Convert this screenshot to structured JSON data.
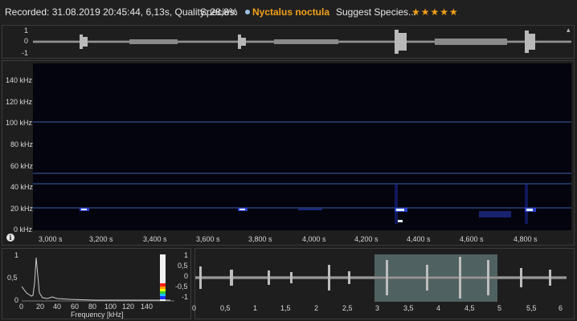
{
  "header": {
    "recorded": "Recorded: 31.08.2019 20:45:44, 6,13s, Quality: 28,8%",
    "species_label": "Species:",
    "species_name": "Nyctalus noctula",
    "suggest_label": "Suggest Species...",
    "stars": "★★★★★",
    "accent_color": "#f2a019"
  },
  "waveform_top": {
    "y_ticks": [
      "1",
      "0",
      "-1"
    ]
  },
  "spectrogram": {
    "y_ticks": [
      "140 kHz",
      "120 kHz",
      "100 kHz",
      "80 kHz",
      "60 kHz",
      "40 kHz",
      "20 kHz",
      "0 kHz"
    ],
    "x_ticks": [
      "3,000 s",
      "3,200 s",
      "3,400 s",
      "3,600 s",
      "3,800 s",
      "4,000 s",
      "4,200 s",
      "4,400 s",
      "4,600 s",
      "4,800 s"
    ],
    "marker_lines_khz": [
      100,
      52,
      42,
      20
    ],
    "info_icon": "info-icon"
  },
  "spectrum": {
    "y_ticks": [
      "1",
      "0,5",
      "0"
    ],
    "x_ticks": [
      "0",
      "20",
      "40",
      "60",
      "80",
      "100",
      "120",
      "140"
    ],
    "xlabel": "Frequency [kHz]"
  },
  "overview": {
    "y_ticks": [
      "1",
      "0,5",
      "0",
      "-0,5",
      "-1"
    ],
    "x_ticks": [
      "0",
      "0,5",
      "1",
      "1,5",
      "2",
      "2,5",
      "3",
      "3,5",
      "4",
      "4,5",
      "5",
      "5,5",
      "6"
    ],
    "selection_start_s": 2.95,
    "selection_end_s": 4.97
  }
}
